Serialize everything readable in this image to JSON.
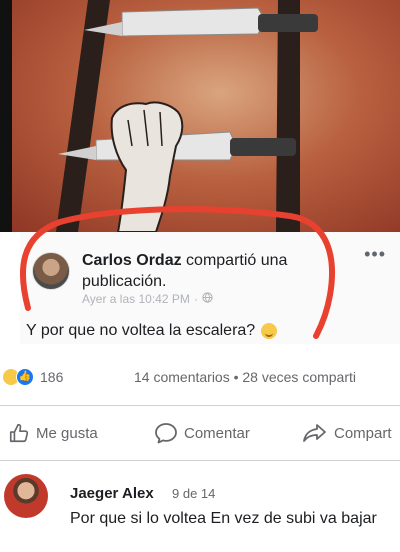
{
  "post": {
    "author": "Carlos Ordaz",
    "action": "compartió una publicación.",
    "timestamp": "Ayer a las 10:42 PM",
    "text": "Y por que no voltea la escalera?",
    "menu": "•••"
  },
  "stats": {
    "reaction_count": "186",
    "comments_shares": "14 comentarios • 28 veces comparti"
  },
  "actions": {
    "like": "Me gusta",
    "comment": "Comentar",
    "share": "Compart"
  },
  "comment": {
    "author": "Jaeger Alex",
    "date": "9 de 14",
    "text": "Por que si lo voltea En vez de subi va bajar"
  },
  "colors": {
    "accent": "#1877f2",
    "annotation": "#e8412f",
    "background": "#ffffff"
  },
  "icons": [
    "globe-icon",
    "haha-reaction-icon",
    "like-reaction-icon",
    "thumbs-up-icon",
    "comment-bubble-icon",
    "share-arrow-icon"
  ]
}
